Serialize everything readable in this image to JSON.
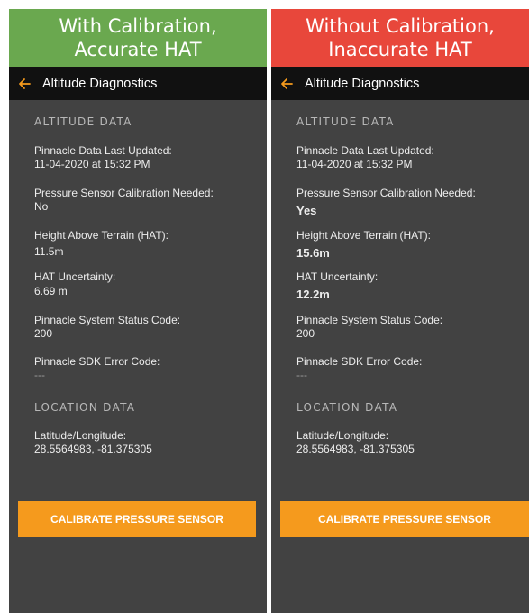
{
  "left": {
    "banner": [
      "With Calibration,",
      "Accurate HAT"
    ],
    "banner_color": "#6aa84f",
    "screen_title": "Altitude Diagnostics",
    "altitude_section": "ALTITUDE DATA",
    "last_updated_label": "Pinnacle Data Last Updated:",
    "last_updated_value": "11-04-2020 at 15:32 PM",
    "calibration_needed_label": "Pressure Sensor Calibration Needed:",
    "calibration_needed_value": "No",
    "hat_label": "Height Above Terrain (HAT):",
    "hat_value": "11.5m",
    "hat_uncertainty_label": "HAT Uncertainty:",
    "hat_uncertainty_value": "6.69 m",
    "status_code_label": "Pinnacle System Status Code:",
    "status_code_value": "200",
    "sdk_error_label": "Pinnacle SDK Error Code:",
    "sdk_error_value": "---",
    "location_section": "LOCATION DATA",
    "latlon_label": "Latitude/Longitude:",
    "latlon_value": "28.5564983, -81.375305",
    "calibrate_button": "CALIBRATE PRESSURE SENSOR"
  },
  "right": {
    "banner": [
      "Without Calibration,",
      "Inaccurate HAT"
    ],
    "banner_color": "#e8473b",
    "screen_title": "Altitude Diagnostics",
    "altitude_section": "ALTITUDE DATA",
    "last_updated_label": "Pinnacle Data Last Updated:",
    "last_updated_value": "11-04-2020 at 15:32 PM",
    "calibration_needed_label": "Pressure Sensor Calibration Needed:",
    "calibration_needed_value": "Yes",
    "hat_label": "Height Above Terrain (HAT):",
    "hat_value": "15.6m",
    "hat_uncertainty_label": "HAT Uncertainty:",
    "hat_uncertainty_value": "12.2m",
    "status_code_label": "Pinnacle System Status Code:",
    "status_code_value": "200",
    "sdk_error_label": "Pinnacle SDK Error Code:",
    "sdk_error_value": "---",
    "location_section": "LOCATION DATA",
    "latlon_label": "Latitude/Longitude:",
    "latlon_value": "28.5564983, -81.375305",
    "calibrate_button": "CALIBRATE PRESSURE SENSOR"
  },
  "colors": {
    "accent": "#f59a1d",
    "screen_bg": "#424242",
    "topbar_bg": "#111111"
  },
  "icons": {
    "back": "back-arrow-icon"
  }
}
